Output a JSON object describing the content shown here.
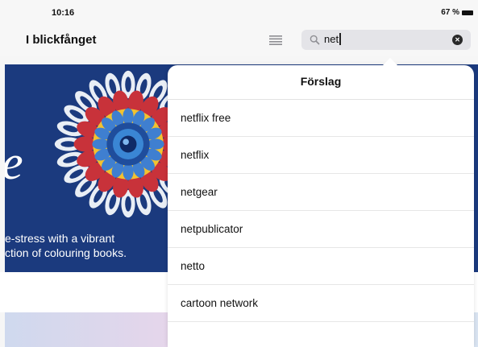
{
  "status_bar": {
    "time": "10:16",
    "battery": "67 %"
  },
  "nav": {
    "title": "I blickfånget",
    "list_icon": "list-icon",
    "search": {
      "value": "net",
      "icon": "search-icon",
      "clear_icon": "clear-icon"
    }
  },
  "banner": {
    "letter": "e",
    "line1": "e-stress with a vibrant",
    "line2": "ction of colouring books."
  },
  "popover": {
    "title": "Förslag",
    "suggestions": [
      "netflix free",
      "netflix",
      "netgear",
      "netpublicator",
      "netto",
      "cartoon network"
    ]
  },
  "colors": {
    "banner_background": "#1b3a7e",
    "popover_background": "#ffffff",
    "search_field": "#e4e4e8"
  }
}
